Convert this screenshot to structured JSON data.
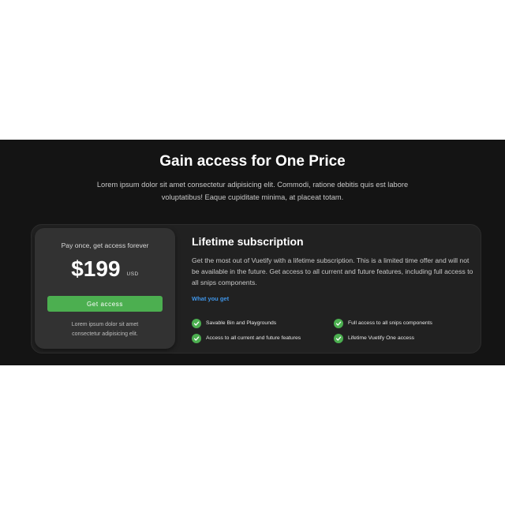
{
  "hero": {
    "title": "Gain access for One Price",
    "subtitle": "Lorem ipsum dolor sit amet consectetur adipisicing elit. Commodi, ratione debitis quis est labore voluptatibus! Eaque cupiditate minima, at placeat totam."
  },
  "pricing": {
    "pay_label": "Pay once, get access forever",
    "price": "$199",
    "currency": "USD",
    "cta_label": "Get access",
    "note": "Lorem ipsum dolor sit amet consectetur adipisicing elit."
  },
  "plan": {
    "title": "Lifetime subscription",
    "description": "Get the most out of Vuetify with a lifetime subscription. This is a limited time offer and will not be available in the future. Get access to all current and future features, including full access to all snips components.",
    "link_label": "What you get",
    "features": [
      "Savable Bin and Playgrounds",
      "Full access to all snips components",
      "Access to all current and future features",
      "Lifetime Vuetify One access"
    ]
  },
  "colors": {
    "band_background": "#141414",
    "accent_green": "#4caf50",
    "link_blue": "#3f94e6"
  },
  "icons": {
    "feature_check": "check-circle-icon"
  }
}
